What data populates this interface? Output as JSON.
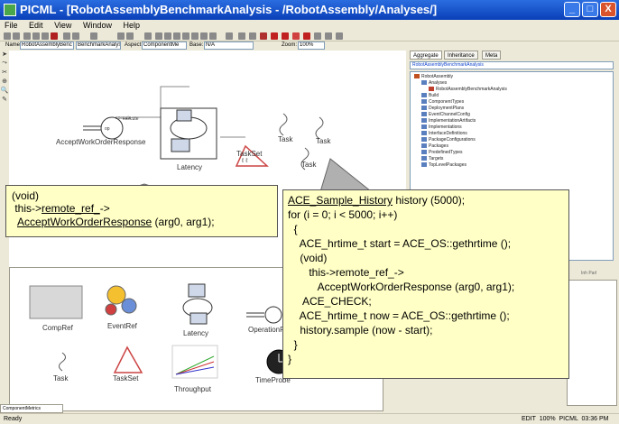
{
  "window": {
    "title": "PICML - [RobotAssemblyBenchmarkAnalysis - /RobotAssembly/Analyses/]",
    "controls": [
      "_",
      "□",
      "X"
    ]
  },
  "menu": [
    "File",
    "Edit",
    "View",
    "Window",
    "Help"
  ],
  "toolbar2": {
    "name_label": "Name:",
    "name_value": "RobotAssemblyBenc",
    "kind_value": "BenchmarkAnalysis",
    "aspect_label": "Aspect:",
    "aspect_value": "ComponentMe",
    "base_label": "Base:",
    "base_value": "N/A",
    "zoom_label": "Zoom:",
    "zoom_value": "100%"
  },
  "canvas": {
    "nodes": {
      "accept": "AcceptWorkOrderResponse",
      "accept_port": "execute",
      "latency": "Latency",
      "taskset": "TaskSet",
      "task1": "Task",
      "task2": "Task",
      "task3": "Task"
    }
  },
  "callout_small": {
    "line1": "(void)",
    "line2a": " this->",
    "line2b": "remote_ref_",
    "line2c": "->",
    "line3a": "  ",
    "line3b": "AcceptWorkOrderResponse",
    "line3c": " (arg0, arg1);"
  },
  "callout_big": {
    "l1a": "ACE_Sample_History",
    "l1b": " history (5000);",
    "l2": "for (i = 0; i < 5000; i++)",
    "l3": "  {",
    "l4": "    ACE_hrtime_t start = ACE_OS::gethrtime ();",
    "l5": "    (void)",
    "l6": "       this->remote_ref_->",
    "l7": "          AcceptWorkOrderResponse (arg0, arg1);",
    "l8": "     ACE_CHECK;",
    "l9": "    ACE_hrtime_t now = ACE_OS::gethrtime ();",
    "l10": "    history.sample (now - start);",
    "l11": "  }",
    "l12": "}"
  },
  "right_panel": {
    "tabs": [
      "Aggregate",
      "Inheritance",
      "Meta"
    ],
    "combo": "RobotAssemblyBenchmarkAnalysis",
    "tree": [
      "RobotAssembly",
      "Analyses",
      "RobotAssemblyBenchmarkAnalysis",
      "Build",
      "ComponentTypes",
      "DeploymentPlans",
      "EventChannelConfig",
      "ImplementationArtifacts",
      "Implementations",
      "InterfaceDefinitions",
      "PackageConfigurations",
      "Packages",
      "PredefinedTypes",
      "Targets",
      "TopLevelPackages"
    ],
    "checkbox_label": "Inh Parl"
  },
  "palette": {
    "items": [
      "CompRef",
      "EventRef",
      "Latency",
      "OperationRef",
      "Task",
      "TaskSet",
      "Throughput",
      "TimeProbe"
    ],
    "tab": "ComponentMetrics"
  },
  "status": {
    "left": "Ready",
    "right": "EDIT  100%  PICML  03:36 PM"
  }
}
